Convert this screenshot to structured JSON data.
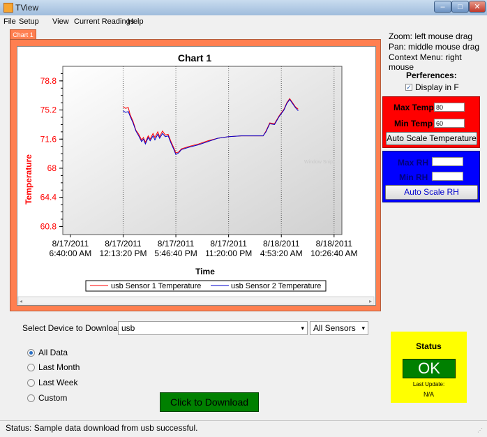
{
  "window": {
    "title": "TView",
    "minimize_glyph": "–",
    "maximize_glyph": "□",
    "close_glyph": "✕"
  },
  "menu": [
    "File",
    "Setup",
    "View",
    "Current Readings",
    "Help"
  ],
  "tab": {
    "label": "Chart 1"
  },
  "chart_data": {
    "type": "line",
    "title": "Chart 1",
    "xlabel": "Time",
    "ylabel": "Temperature",
    "y_ticks": [
      "78.8",
      "75.2",
      "71.6",
      "68",
      "64.4",
      "60.8"
    ],
    "y_tick_values": [
      78.8,
      75.2,
      71.6,
      68,
      64.4,
      60.8
    ],
    "x_ticks": [
      [
        "8/17/2011",
        "6:40:00 AM"
      ],
      [
        "8/17/2011",
        "12:13:20 PM"
      ],
      [
        "8/17/2011",
        "5:46:40 PM"
      ],
      [
        "8/17/2011",
        "11:20:00 PM"
      ],
      [
        "8/18/2011",
        "4:53:20 AM"
      ],
      [
        "8/18/2011",
        "10:26:40 AM"
      ]
    ],
    "x_tick_hours": [
      0,
      5.5556,
      11.1111,
      16.6667,
      22.2222,
      27.7778
    ],
    "x_unit": "hours after 8/17/2011 6:40:00 AM",
    "ylim": [
      59.8,
      80.6
    ],
    "xlim": [
      -0.8,
      28.6
    ],
    "grid": "vertical dotted",
    "legend": "bottom",
    "series": [
      {
        "name": "usb Sensor 1 Temperature",
        "color": "#ff0000",
        "points": [
          [
            5.56,
            75.6
          ],
          [
            5.8,
            75.4
          ],
          [
            6.1,
            75.5
          ],
          [
            6.3,
            74.6
          ],
          [
            6.6,
            73.8
          ],
          [
            6.9,
            72.7
          ],
          [
            7.2,
            72.2
          ],
          [
            7.5,
            71.5
          ],
          [
            7.7,
            71.8
          ],
          [
            7.9,
            71.2
          ],
          [
            8.2,
            72.0
          ],
          [
            8.4,
            71.6
          ],
          [
            8.7,
            72.3
          ],
          [
            8.9,
            71.8
          ],
          [
            9.2,
            72.5
          ],
          [
            9.4,
            71.9
          ],
          [
            9.7,
            72.6
          ],
          [
            10.0,
            72.1
          ],
          [
            10.3,
            72.2
          ],
          [
            10.6,
            71.3
          ],
          [
            10.9,
            70.5
          ],
          [
            11.11,
            69.9
          ],
          [
            11.4,
            70.0
          ],
          [
            11.7,
            70.4
          ],
          [
            12.5,
            70.7
          ],
          [
            13.5,
            71.0
          ],
          [
            14.5,
            71.4
          ],
          [
            15.5,
            71.7
          ],
          [
            16.67,
            71.9
          ],
          [
            18.0,
            72.0
          ],
          [
            19.0,
            72.0
          ],
          [
            20.3,
            72.0
          ],
          [
            20.6,
            72.6
          ],
          [
            21.0,
            73.6
          ],
          [
            21.5,
            73.5
          ],
          [
            22.0,
            74.5
          ],
          [
            22.5,
            75.3
          ],
          [
            22.8,
            76.1
          ],
          [
            23.1,
            76.6
          ],
          [
            23.4,
            76.1
          ],
          [
            23.7,
            75.6
          ],
          [
            24.0,
            75.3
          ]
        ]
      },
      {
        "name": "usb Sensor 2 Temperature",
        "color": "#0000cc",
        "points": [
          [
            5.56,
            75.1
          ],
          [
            5.8,
            74.9
          ],
          [
            6.1,
            75.0
          ],
          [
            6.3,
            74.4
          ],
          [
            6.6,
            73.6
          ],
          [
            6.9,
            72.6
          ],
          [
            7.2,
            72.0
          ],
          [
            7.5,
            71.3
          ],
          [
            7.7,
            71.6
          ],
          [
            7.9,
            71.0
          ],
          [
            8.2,
            71.8
          ],
          [
            8.4,
            71.4
          ],
          [
            8.7,
            72.0
          ],
          [
            8.9,
            71.5
          ],
          [
            9.2,
            72.2
          ],
          [
            9.4,
            71.7
          ],
          [
            9.7,
            72.3
          ],
          [
            10.0,
            71.9
          ],
          [
            10.3,
            72.0
          ],
          [
            10.6,
            71.1
          ],
          [
            10.9,
            70.3
          ],
          [
            11.11,
            69.7
          ],
          [
            11.4,
            69.9
          ],
          [
            11.7,
            70.3
          ],
          [
            12.5,
            70.6
          ],
          [
            13.5,
            70.9
          ],
          [
            14.5,
            71.3
          ],
          [
            15.5,
            71.7
          ],
          [
            16.67,
            71.9
          ],
          [
            18.0,
            72.0
          ],
          [
            19.0,
            72.0
          ],
          [
            20.3,
            72.0
          ],
          [
            20.6,
            72.5
          ],
          [
            21.0,
            73.5
          ],
          [
            21.5,
            73.4
          ],
          [
            22.0,
            74.4
          ],
          [
            22.5,
            75.2
          ],
          [
            22.8,
            76.0
          ],
          [
            23.1,
            76.5
          ],
          [
            23.4,
            76.0
          ],
          [
            23.7,
            75.5
          ],
          [
            24.0,
            75.1
          ]
        ]
      }
    ]
  },
  "chart_watermark": "Window Snip",
  "scroll": {
    "left": "◂",
    "right": "▸"
  },
  "right_panel": {
    "help_lines": [
      "Zoom: left mouse  drag",
      "Pan: middle mouse  drag",
      "Context Menu: right mouse"
    ],
    "preferences_title": "Perferences:",
    "display_in_f": {
      "label": "Display in F",
      "checked": true
    },
    "temp": {
      "max_label": "Max Temp",
      "max_value": "80",
      "min_label": "Min Temp",
      "min_value": "60",
      "autoscale_label": "Auto Scale Temperature"
    },
    "rh": {
      "max_label": "Max RH",
      "max_value": "",
      "min_label": "Min RH",
      "min_value": "",
      "autoscale_label": "Auto Scale RH"
    }
  },
  "download": {
    "device_label": "Select Device to Download",
    "device_value": "usb",
    "sensor_value": "All Sensors",
    "dropdown_glyph": "▾",
    "ranges": [
      {
        "label": "All Data",
        "selected": true
      },
      {
        "label": "Last Month",
        "selected": false
      },
      {
        "label": "Last Week",
        "selected": false
      },
      {
        "label": "Custom",
        "selected": false
      }
    ],
    "button_label": "Click to Download"
  },
  "status_panel": {
    "title": "Status",
    "state": "OK",
    "last_update_label": "Last Update:",
    "last_update_value": "N/A"
  },
  "statusbar": {
    "text": "Status:  Sample data download from usb successful."
  },
  "colors": {
    "chart_frame": "#ff7f50",
    "temp_box": "#ff0000",
    "rh_box": "#0000ff",
    "status_panel": "#ffff00",
    "ok": "#008000"
  }
}
